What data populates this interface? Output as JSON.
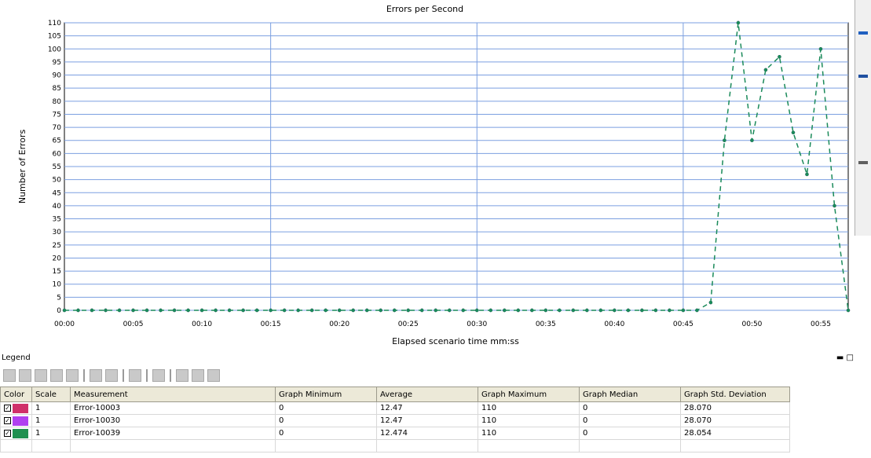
{
  "chart_data": {
    "type": "line",
    "title": "Errors per Second",
    "xlabel": "Elapsed scenario time mm:ss",
    "ylabel": "Number of Errors",
    "x_ticks": [
      "00:00",
      "00:05",
      "00:10",
      "00:15",
      "00:20",
      "00:25",
      "00:30",
      "00:35",
      "00:40",
      "00:45",
      "00:50",
      "00:55"
    ],
    "y_ticks": [
      0,
      5,
      10,
      15,
      20,
      25,
      30,
      35,
      40,
      45,
      50,
      55,
      60,
      65,
      70,
      75,
      80,
      85,
      90,
      95,
      100,
      105,
      110
    ],
    "xlim": [
      0,
      57
    ],
    "ylim": [
      0,
      110
    ],
    "grid": true,
    "series": [
      {
        "name": "Error-10003",
        "color": "#7a2a3a",
        "values": [
          0,
          0,
          0,
          0,
          0,
          0,
          0,
          0,
          0,
          0,
          0,
          0,
          0,
          0,
          0,
          0,
          0,
          0,
          0,
          0,
          0,
          0,
          0,
          0,
          0,
          0,
          0,
          0,
          0,
          0,
          0,
          0,
          0,
          0,
          0,
          0,
          0,
          0,
          0,
          0,
          0,
          0,
          0,
          0,
          0,
          0,
          0,
          3,
          65,
          110,
          65,
          92,
          97,
          68,
          52,
          100,
          40,
          0
        ]
      },
      {
        "name": "Error-10030",
        "color": "#6a2a9a",
        "values": [
          0,
          0,
          0,
          0,
          0,
          0,
          0,
          0,
          0,
          0,
          0,
          0,
          0,
          0,
          0,
          0,
          0,
          0,
          0,
          0,
          0,
          0,
          0,
          0,
          0,
          0,
          0,
          0,
          0,
          0,
          0,
          0,
          0,
          0,
          0,
          0,
          0,
          0,
          0,
          0,
          0,
          0,
          0,
          0,
          0,
          0,
          0,
          3,
          65,
          110,
          65,
          92,
          97,
          68,
          52,
          100,
          40,
          0
        ]
      },
      {
        "name": "Error-10039",
        "color": "#1a8a5a",
        "values": [
          0,
          0,
          0,
          0,
          0,
          0,
          0,
          0,
          0,
          0,
          0,
          0,
          0,
          0,
          0,
          0,
          0,
          0,
          0,
          0,
          0,
          0,
          0,
          0,
          0,
          0,
          0,
          0,
          0,
          0,
          0,
          0,
          0,
          0,
          0,
          0,
          0,
          0,
          0,
          0,
          0,
          0,
          0,
          0,
          0,
          0,
          0,
          3,
          65,
          110,
          65,
          92,
          97,
          68,
          52,
          100,
          40,
          0
        ]
      }
    ]
  },
  "legend": {
    "label": "Legend",
    "minmax": "▬ □",
    "columns": [
      "Color",
      "Scale",
      "Measurement",
      "Graph Minimum",
      "Average",
      "Graph Maximum",
      "Graph Median",
      "Graph Std. Deviation"
    ],
    "rows": [
      {
        "color": "#d0306a",
        "scale": "1",
        "measurement": "Error-10003",
        "min": "0",
        "avg": "12.47",
        "max": "110",
        "median": "0",
        "std": "28.070"
      },
      {
        "color": "#b040f0",
        "scale": "1",
        "measurement": "Error-10030",
        "min": "0",
        "avg": "12.47",
        "max": "110",
        "median": "0",
        "std": "28.070"
      },
      {
        "color": "#209050",
        "scale": "1",
        "measurement": "Error-10039",
        "min": "0",
        "avg": "12.474",
        "max": "110",
        "median": "0",
        "std": "28.054"
      }
    ]
  }
}
